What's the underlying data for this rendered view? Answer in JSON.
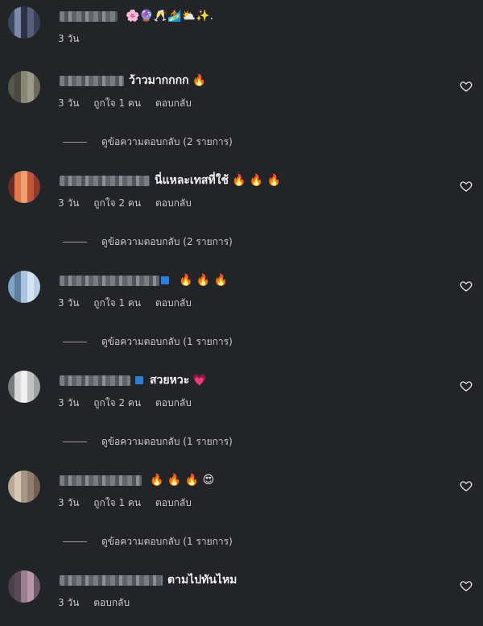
{
  "comments": [
    {
      "text": "",
      "emojis": "🌸🔮🥂🏄⛅✨.",
      "time": "3 วัน",
      "likes": "",
      "reply": "",
      "view_replies": "",
      "avatar_colors": [
        "#3c4660",
        "#556078",
        "#7d8aa6",
        "#3a4054",
        "#2d3244"
      ]
    },
    {
      "text": "ว้าวมากกกก",
      "emojis": "🔥",
      "time": "3 วัน",
      "likes": "ถูกใจ 1 คน",
      "reply": "ตอบกลับ",
      "view_replies": "ดูข้อความตอบกลับ (2 รายการ)",
      "avatar_colors": [
        "#6d6a5d",
        "#8a8676",
        "#55584b",
        "#9c9a8a",
        "#4a4a42"
      ]
    },
    {
      "text": "นี่แหละเทสที่ใช้",
      "emojis": "🔥 🔥 🔥",
      "time": "3 วัน",
      "likes": "ถูกใจ 2 คน",
      "reply": "ตอบกลับ",
      "view_replies": "ดูข้อความตอบกลับ (2 รายการ)",
      "avatar_colors": [
        "#c0553a",
        "#e07a4d",
        "#8c3b2c",
        "#f0a070",
        "#6b2a22"
      ]
    },
    {
      "text": "",
      "emojis": "🔥 🔥 🔥",
      "time": "3 วัน",
      "likes": "ถูกใจ 1 คน",
      "reply": "ตอบกลับ",
      "view_replies": "ดูข้อความตอบกลับ (1 รายการ)",
      "avatar_colors": [
        "#a8c4e0",
        "#7fa3c7",
        "#d6e4f0",
        "#5f7f9f",
        "#b9cfe3"
      ]
    },
    {
      "text": "สวยหวะ",
      "emojis": "💗",
      "time": "3 วัน",
      "likes": "ถูกใจ 2 คน",
      "reply": "ตอบกลับ",
      "view_replies": "ดูข้อความตอบกลับ (1 รายการ)",
      "avatar_colors": [
        "#d8d8d8",
        "#a0a0a0",
        "#f0f0f0",
        "#7a7a7a",
        "#c2c2c2"
      ]
    },
    {
      "text": "",
      "emojis": "🔥 🔥 🔥 😍",
      "time": "3 วัน",
      "likes": "ถูกใจ 1 คน",
      "reply": "ตอบกลับ",
      "view_replies": "ดูข้อความตอบกลับ (1 รายการ)",
      "avatar_colors": [
        "#b8a898",
        "#8f7f70",
        "#d6c6b4",
        "#6e6052",
        "#a69686"
      ]
    },
    {
      "text": "ตามไปทันไหม",
      "emojis": "",
      "time": "3 วัน",
      "likes": "",
      "reply": "ตอบกลับ",
      "view_replies": "",
      "avatar_colors": [
        "#6f5a6a",
        "#9a7f8f",
        "#4c3e4a",
        "#b898a8",
        "#5a4a56"
      ]
    }
  ],
  "colors": {
    "background": "#232428",
    "text": "#f1f1f1",
    "muted": "#c8c8c8",
    "badge": "#2f7fd6"
  }
}
